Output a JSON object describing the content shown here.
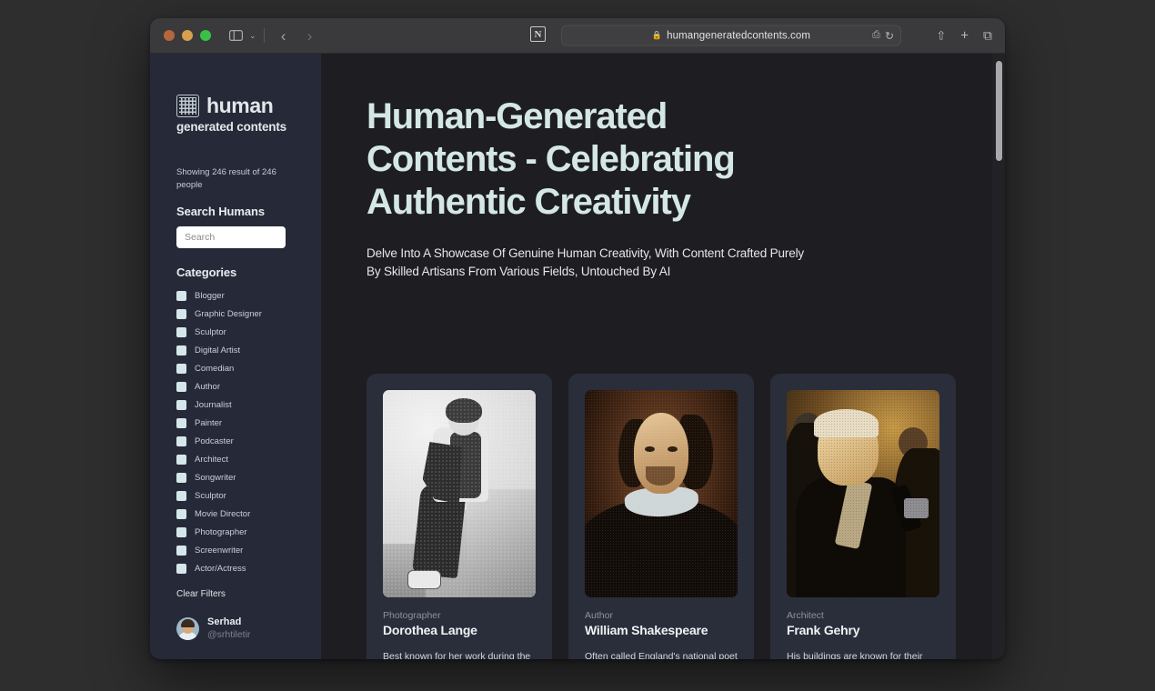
{
  "browser": {
    "url": "humangeneratedcontents.com",
    "lock_icon": "lock-icon",
    "favicon_letter": "N",
    "traffic_lights": [
      "close-button",
      "minimize-button",
      "maximize-button"
    ],
    "back_glyph": "‹",
    "forward_glyph": "›",
    "chevron_glyph": "⌄",
    "share_glyph": "⇧",
    "new_tab_glyph": "+",
    "tabs_glyph": "⧉",
    "reload_glyph": "↻",
    "extensions_glyph": "⎙"
  },
  "sidebar": {
    "brand_word": "human",
    "brand_sub": "generated contents",
    "results_text": "Showing 246 result of 246 people",
    "search_heading": "Search Humans",
    "search_value": "",
    "search_placeholder": "Search",
    "categories_heading": "Categories",
    "categories": [
      "Blogger",
      "Graphic Designer",
      "Sculptor",
      "Digital Artist",
      "Comedian",
      "Author",
      "Journalist",
      "Painter",
      "Podcaster",
      "Architect",
      "Songwriter",
      "Sculptor",
      "Movie Director",
      "Photographer",
      "Screenwriter",
      "Actor/Actress"
    ],
    "clear_filters": "Clear Filters",
    "user": {
      "name": "Serhad",
      "handle": "@srhtiletir"
    }
  },
  "main": {
    "title": "Human-Generated Contents - Celebrating Authentic Creativity",
    "subtitle": "Delve Into A Showcase Of Genuine Human Creativity, With Content Crafted Purely By Skilled Artisans From Various Fields, Untouched By AI",
    "cards": [
      {
        "role": "Photographer",
        "name": "Dorothea Lange",
        "description": "Best known for her work during the Great Depression",
        "image": "dorothea-lange-photo"
      },
      {
        "role": "Author",
        "name": "William Shakespeare",
        "description": "Often called England's national poet",
        "image": "william-shakespeare-portrait"
      },
      {
        "role": "Architect",
        "name": "Frank Gehry",
        "description": "His buildings are known for their striking, sculptural forms",
        "image": "frank-gehry-photo"
      }
    ]
  },
  "colors": {
    "sidebar_bg": "#262a38",
    "main_bg": "#1e1e22",
    "card_bg": "#2a2d3a",
    "accent_mint": "#d4e7e4",
    "checkbox": "#d5e7ea"
  }
}
